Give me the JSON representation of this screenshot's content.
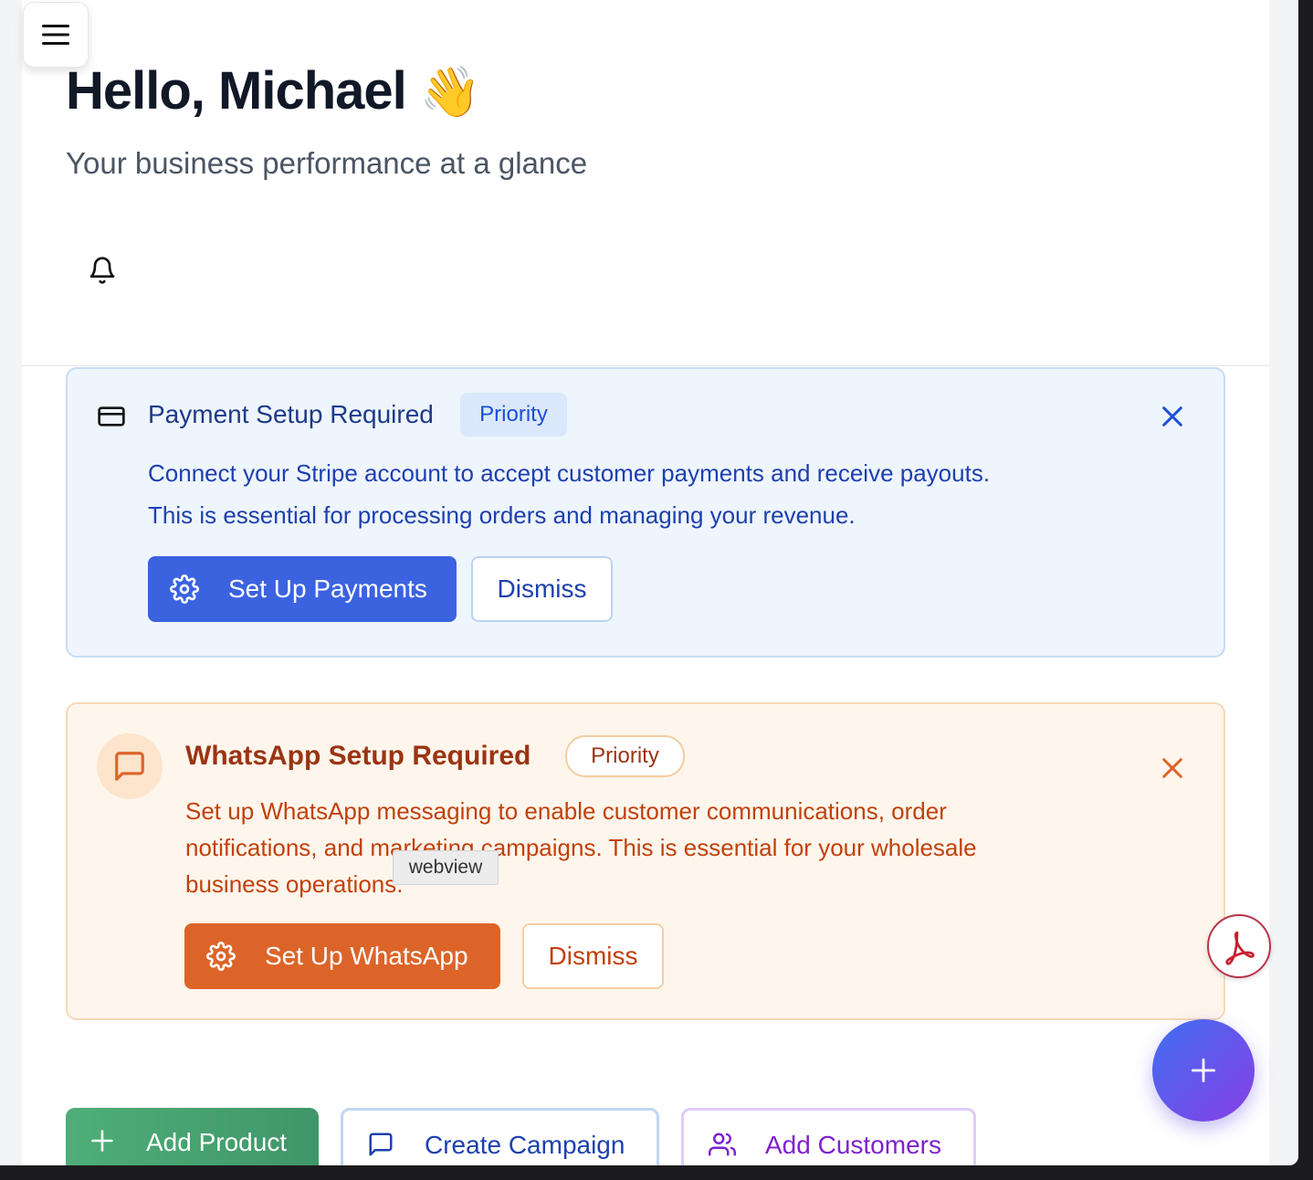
{
  "header": {
    "greeting": "Hello, Michael",
    "wave_emoji": "👋",
    "subtitle": "Your business performance at a glance"
  },
  "icons": {
    "menu": "hamburger-menu-icon",
    "bell": "bell-icon",
    "card": "credit-card-icon",
    "gear": "gear-icon",
    "close": "close-icon",
    "message": "message-square-icon",
    "pdf": "acrobat-pdf-icon",
    "plus": "plus-icon",
    "users": "users-icon"
  },
  "alerts": {
    "payment": {
      "title": "Payment Setup Required",
      "badge": "Priority",
      "line1": "Connect your Stripe account to accept customer payments and receive payouts.",
      "line2": "This is essential for processing orders and managing your revenue.",
      "primary_label": "Set Up Payments",
      "dismiss_label": "Dismiss",
      "accent": "#3b63e0"
    },
    "whatsapp": {
      "title": "WhatsApp Setup Required",
      "badge": "Priority",
      "line1": "Set up WhatsApp messaging to enable customer communications, order",
      "line2": "notifications, and marketing campaigns. This is essential for your wholesale",
      "line3": "business operations.",
      "primary_label": "Set Up WhatsApp",
      "dismiss_label": "Dismiss",
      "accent": "#dd6428"
    }
  },
  "tooltip": {
    "text": "webview"
  },
  "quick_actions": {
    "add_product": "Add Product",
    "create_campaign": "Create Campaign",
    "add_customers": "Add Customers"
  }
}
